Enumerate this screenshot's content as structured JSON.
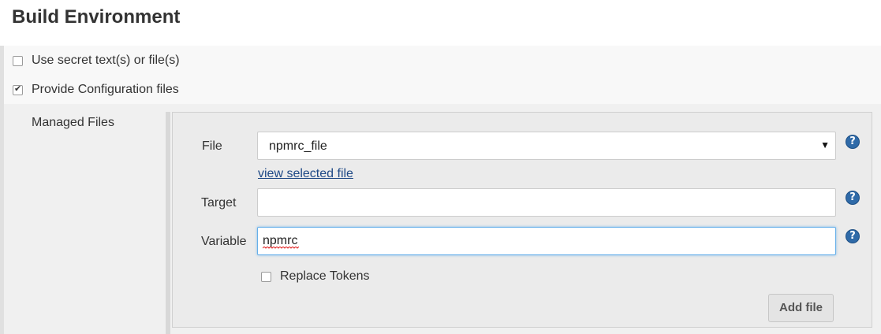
{
  "section": {
    "title": "Build Environment"
  },
  "options": [
    {
      "label": "Use secret text(s) or file(s)",
      "checked": false
    },
    {
      "label": "Provide Configuration files",
      "checked": true
    }
  ],
  "managed_files": {
    "label": "Managed Files",
    "file": {
      "label": "File",
      "selected": "npmrc_file"
    },
    "view_link": "view selected file",
    "target": {
      "label": "Target",
      "value": ""
    },
    "variable": {
      "label": "Variable",
      "value": "npmrc"
    },
    "replace_tokens": {
      "label": "Replace Tokens",
      "checked": false
    },
    "add_button": "Add file",
    "help_glyph": "?"
  },
  "colors": {
    "accent": "#2f6aa8",
    "link": "#204a87",
    "focus": "#66afe9"
  },
  "icons": [
    "checkbox-icon",
    "dropdown-arrow-icon",
    "help-icon"
  ]
}
